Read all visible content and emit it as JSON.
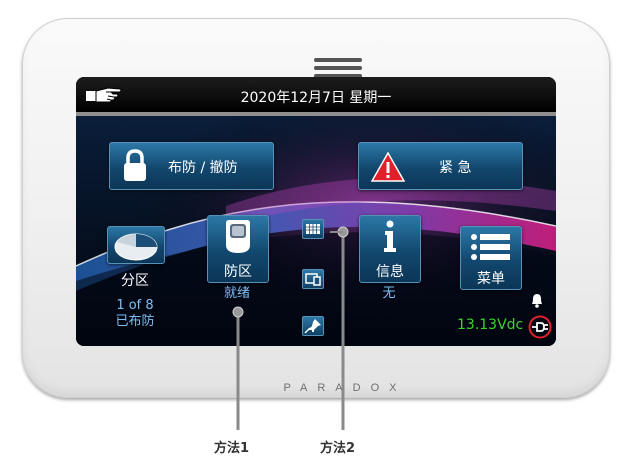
{
  "header": {
    "datetime": "2020年12月7日 星期一"
  },
  "buttons": {
    "arm_disarm": "布防 / 撤防",
    "emergency": "紧 急",
    "partition": "分区",
    "zone": "防区",
    "info": "信息",
    "menu": "菜单"
  },
  "status": {
    "partition_count": "1 of 8",
    "partition_state": "已布防",
    "zone_state": "就绪",
    "info_state": "无",
    "voltage": "13.13Vdc"
  },
  "device": {
    "brand": "PARADOX"
  },
  "callouts": {
    "method1": "方法1",
    "method2": "方法2"
  },
  "icons": {
    "top_left": "hand-pointing-icon",
    "arm": "padlock-icon",
    "emergency": "warning-triangle-icon",
    "partition": "pie-icon",
    "zone": "motion-sensor-icon",
    "info": "info-i-icon",
    "menu": "list-icon",
    "side_1": "keypad-icon",
    "side_2": "devices-icon",
    "side_3": "pushpin-icon",
    "bell": "bell-icon",
    "power": "ac-plug-fault-icon"
  },
  "colors": {
    "button_blue": "#12476e",
    "sub_text": "#7dbff2",
    "voltage_green": "#3cd52c",
    "alert_red": "#e0202a"
  }
}
